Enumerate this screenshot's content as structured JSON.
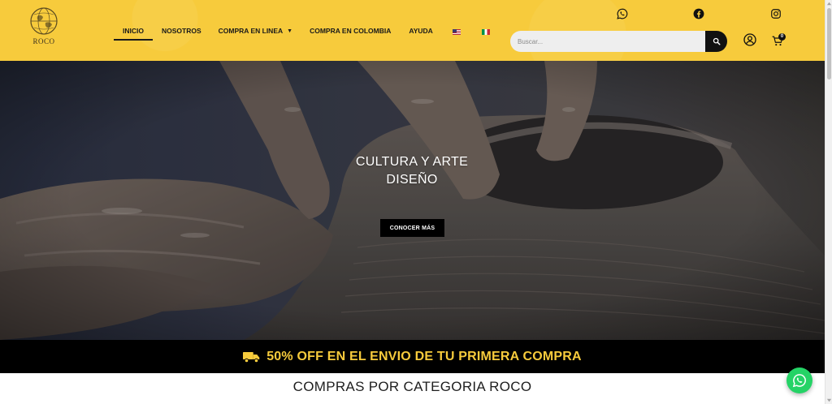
{
  "brand": {
    "logo_text": "ROCO"
  },
  "nav": {
    "items": [
      {
        "label": "INICIO",
        "active": true
      },
      {
        "label": "NOSOTROS"
      },
      {
        "label": "COMPRA EN LINEA",
        "has_dropdown": true
      },
      {
        "label": "COMPRA EN COLOMBIA"
      },
      {
        "label": "AYUDA"
      }
    ],
    "languages": [
      "en-us-flag",
      "it-flag"
    ]
  },
  "social": [
    "whatsapp-icon",
    "facebook-icon",
    "instagram-icon"
  ],
  "search": {
    "placeholder": "Buscar..."
  },
  "cart": {
    "count": "0"
  },
  "hero": {
    "title_line1": "CULTURA Y ARTE",
    "title_line2": "DISEÑO",
    "button_label": "CONOCER MÁS"
  },
  "promo": {
    "text": "50% OFF EN EL ENVIO DE TU PRIMERA COMPRA",
    "icon": "truck-icon"
  },
  "section": {
    "title": "COMPRAS POR CATEGORIA ROCO"
  },
  "colors": {
    "brand_yellow": "#f7cb3c",
    "black": "#000000",
    "whatsapp_green": "#25d366"
  }
}
